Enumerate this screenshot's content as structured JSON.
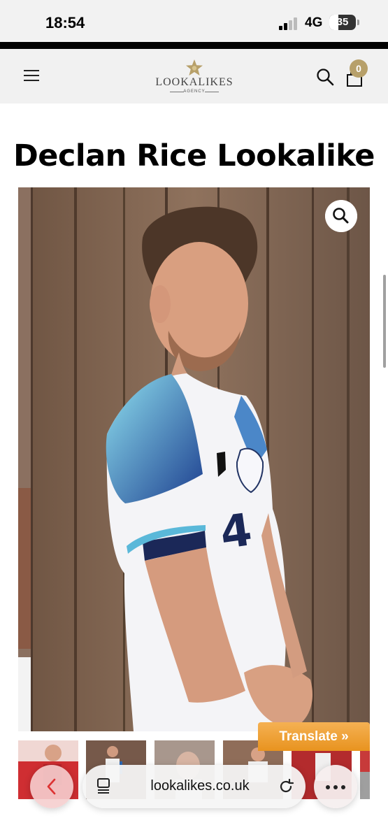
{
  "status_bar": {
    "time": "18:54",
    "network": "4G",
    "battery": "35",
    "battery_level_fraction": 0.35
  },
  "header": {
    "logo_text": "LOOKALIKES",
    "logo_subtext": "AGENCY",
    "cart_count": "0",
    "menu_icon": "hamburger-menu-icon",
    "search_icon": "search-icon",
    "cart_icon": "shopping-bag-icon"
  },
  "product": {
    "title": "Declan Rice Lookalike",
    "main_image": "man-in-white-football-shirt-number-4",
    "zoom_icon": "magnifier-icon",
    "thumbnails": [
      "thumbnail-red-kit",
      "thumbnail-white-kit",
      "thumbnail-portrait",
      "thumbnail-fence-shot",
      "thumbnail-stadium-red",
      "thumbnail-crowd-red"
    ]
  },
  "translate": {
    "label": "Translate »"
  },
  "browser": {
    "url": "lookalikes.co.uk",
    "back_icon": "chevron-left-icon",
    "tabs_icon": "tabs-icon",
    "reload_icon": "reload-icon",
    "more_icon": "more-dots-icon"
  },
  "colors": {
    "accent": "#b7a06a",
    "translate_orange": "#f0a43a"
  }
}
